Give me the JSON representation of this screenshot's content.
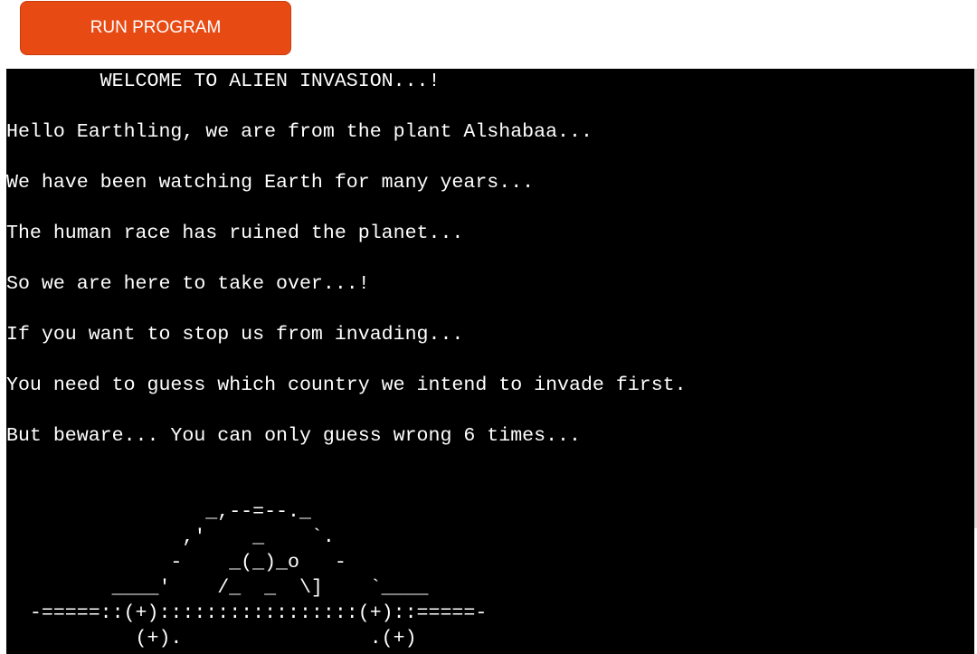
{
  "toolbar": {
    "run_label": "RUN PROGRAM"
  },
  "terminal": {
    "colors": {
      "background": "#000000",
      "text": "#ffffff",
      "button": "#e84a14"
    },
    "lines": [
      "        WELCOME TO ALIEN INVASION...!",
      "",
      "Hello Earthling, we are from the plant Alshabaa...",
      "",
      "We have been watching Earth for many years...",
      "",
      "The human race has ruined the planet...",
      "",
      "So we are here to take over...!",
      "",
      "If you want to stop us from invading...",
      "",
      "You need to guess which country we intend to invade first.",
      "",
      "But beware... You can only guess wrong 6 times...",
      "",
      "",
      "                 _,--=--._",
      "               ,'    _    `.",
      "              -    _(_)_o   -",
      "         ____'    /_  _  \\]    `____",
      "  -=====::(+):::::::::::::::::(+)::=====-",
      "           (+).                .(+)",
      "               .            ,"
    ]
  }
}
